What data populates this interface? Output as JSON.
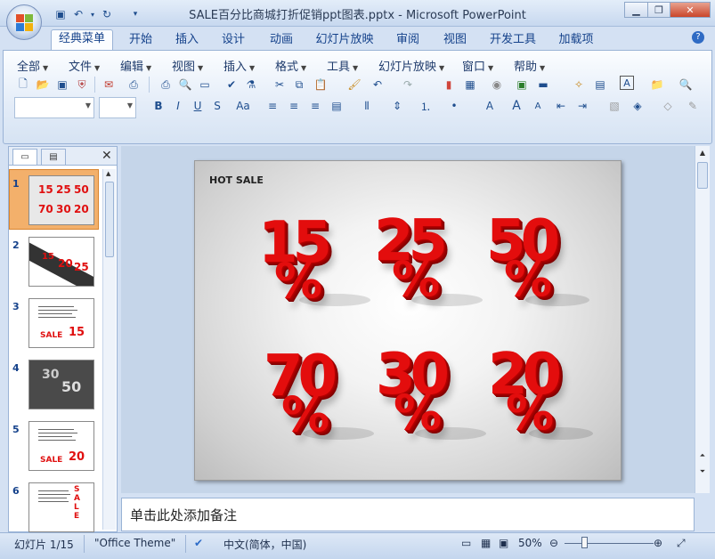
{
  "window": {
    "title": "SALE百分比商城打折促销ppt图表.pptx - Microsoft PowerPoint",
    "controls": [
      "minimize",
      "maximize",
      "close"
    ]
  },
  "quick_access": [
    "save-icon",
    "undo-icon",
    "redo-icon",
    "customize-icon"
  ],
  "tabs": [
    "经典菜单",
    "开始",
    "插入",
    "设计",
    "动画",
    "幻灯片放映",
    "审阅",
    "视图",
    "开发工具",
    "加载项"
  ],
  "active_tab": "经典菜单",
  "menus": [
    "全部",
    "文件",
    "编辑",
    "视图",
    "插入",
    "格式",
    "工具",
    "幻灯片放映",
    "窗口",
    "帮助"
  ],
  "toolbar": {
    "font_name": "",
    "font_size": ""
  },
  "left_pane": {
    "tabs": [
      "slides",
      "outline"
    ],
    "slides": [
      {
        "num": "1",
        "selected": true
      },
      {
        "num": "2",
        "selected": false
      },
      {
        "num": "3",
        "selected": false
      },
      {
        "num": "4",
        "selected": false
      },
      {
        "num": "5",
        "selected": false
      },
      {
        "num": "6",
        "selected": false
      }
    ]
  },
  "slide": {
    "title": "HOT SALE",
    "numbers": [
      "15",
      "25",
      "50",
      "70",
      "30",
      "20"
    ],
    "percent": "%"
  },
  "notes_placeholder": "单击此处添加备注",
  "status": {
    "slide_info": "幻灯片 1/15",
    "theme": "\"Office Theme\"",
    "language": "中文(简体，中国)",
    "zoom": "50%"
  },
  "colors": {
    "accent_red": "#e30d0d",
    "ribbon_blue": "#15428b",
    "selection_orange": "#f0a23c"
  }
}
